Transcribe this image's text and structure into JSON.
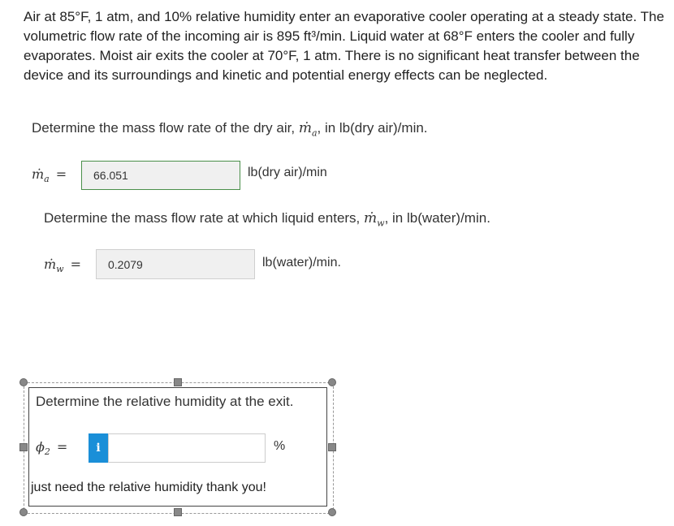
{
  "problem": {
    "text": "Air at 85°F, 1 atm, and 10% relative humidity enter an evaporative cooler operating at a steady state. The volumetric flow rate of the incoming air is 895 ft³/min. Liquid water at 68°F enters the cooler and fully evaporates. Moist air exits the cooler at 70°F, 1 atm. There is no significant heat transfer between the device and its surroundings and kinetic and potential energy effects can be neglected."
  },
  "q1": {
    "prompt_before": "Determine the mass flow rate of the dry air, ",
    "symbol": "ṁ",
    "sub": "a",
    "prompt_after": ",  in lb(dry air)/min.",
    "eq_symbol": "ṁ",
    "eq_sub": "a",
    "eq_sign": "=",
    "answer": "66.051",
    "unit": "lb(dry air)/min"
  },
  "q2": {
    "prompt_before": "Determine the mass flow rate at which liquid enters, ",
    "symbol": "ṁ",
    "sub": "w",
    "prompt_after": ",  in lb(water)/min.",
    "eq_symbol": "ṁ",
    "eq_sub": "w",
    "eq_sign": "=",
    "answer": "0.2079",
    "unit": "lb(water)/min."
  },
  "q3": {
    "prompt": "Determine the relative humidity at the exit.",
    "eq_symbol": "ϕ",
    "eq_sub": "2",
    "eq_sign": "=",
    "info_label": "i",
    "input_value": "",
    "unit": "%",
    "comment": "just need the relative humidity thank you!"
  },
  "colors": {
    "correct_border": "#4a8f4a",
    "info_button": "#1a8fd8"
  }
}
